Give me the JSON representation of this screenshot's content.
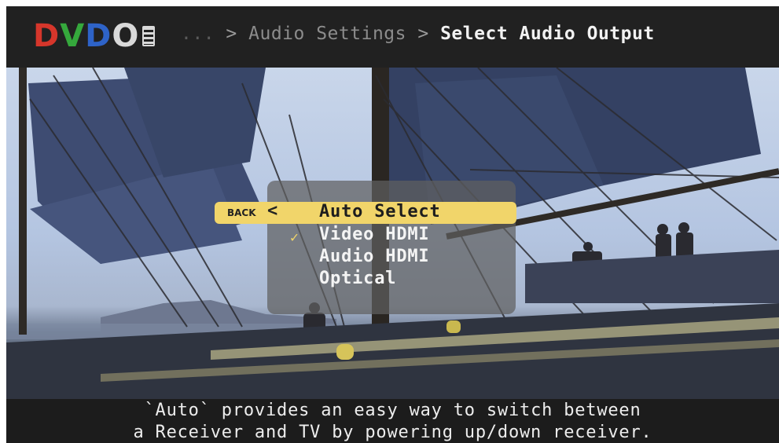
{
  "header": {
    "logo_text": "DVDO",
    "logo_letter_colors": [
      "#d6362b",
      "#35a83c",
      "#2e63c8",
      "#d9d9d9"
    ],
    "breadcrumb": {
      "ellipsis": "...",
      "separator": ">",
      "parent": "Audio Settings",
      "current": "Select Audio Output"
    }
  },
  "menu": {
    "back_label": "BACK",
    "back_icon": "left-arrow-icon",
    "items": [
      {
        "label": "Auto Select",
        "highlighted": true,
        "checked": false
      },
      {
        "label": "Video HDMI",
        "highlighted": false,
        "checked": true
      },
      {
        "label": "Audio HDMI",
        "highlighted": false,
        "checked": false
      },
      {
        "label": "Optical",
        "highlighted": false,
        "checked": false
      }
    ],
    "check_icon": "checkmark-icon",
    "highlight_color": "#f1d56a"
  },
  "help": {
    "line1": "`Auto` provides an easy way to switch between",
    "line2": "a Receiver and TV by powering up/down receiver."
  }
}
